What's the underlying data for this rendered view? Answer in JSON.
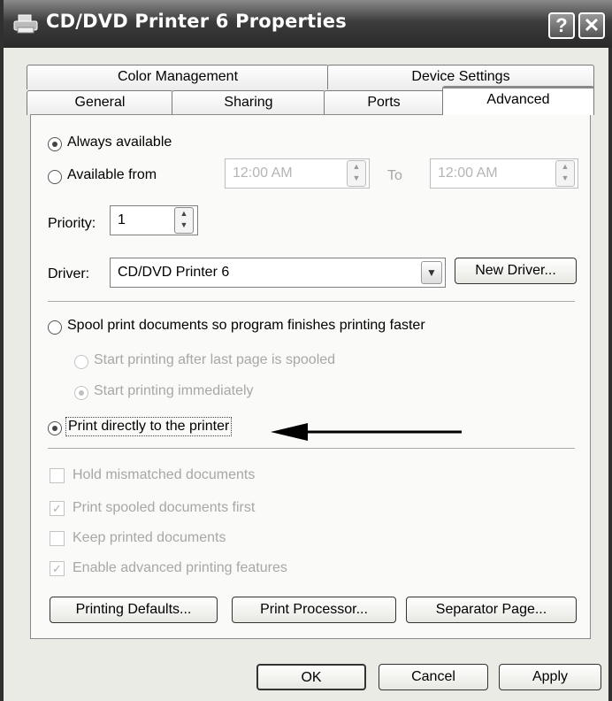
{
  "window": {
    "title": "CD/DVD Printer 6 Properties",
    "help_label": "?",
    "close_label": "✕"
  },
  "tabs": {
    "row1": [
      {
        "label": "Color Management"
      },
      {
        "label": "Device Settings"
      }
    ],
    "row2": [
      {
        "label": "General"
      },
      {
        "label": "Sharing"
      },
      {
        "label": "Ports"
      },
      {
        "label": "Advanced"
      }
    ]
  },
  "availability": {
    "always_label": "Always available",
    "from_label": "Available from",
    "from_time": "12:00 AM",
    "to_label": "To",
    "to_time": "12:00 AM"
  },
  "priority": {
    "label": "Priority:",
    "value": "1"
  },
  "driver": {
    "label": "Driver:",
    "value": "CD/DVD Printer 6",
    "new_driver_label": "New Driver..."
  },
  "spool": {
    "spool_label": "Spool print documents so program finishes printing faster",
    "after_last_label": "Start printing after last page is spooled",
    "immediately_label": "Start printing immediately",
    "direct_label": "Print directly to the printer"
  },
  "options": {
    "hold_label": "Hold mismatched documents",
    "spooled_first_label": "Print spooled documents first",
    "keep_label": "Keep printed documents",
    "advanced_label": "Enable advanced printing features"
  },
  "buttons": {
    "printing_defaults": "Printing Defaults...",
    "print_processor": "Print Processor...",
    "separator_page": "Separator Page...",
    "ok": "OK",
    "cancel": "Cancel",
    "apply": "Apply"
  }
}
